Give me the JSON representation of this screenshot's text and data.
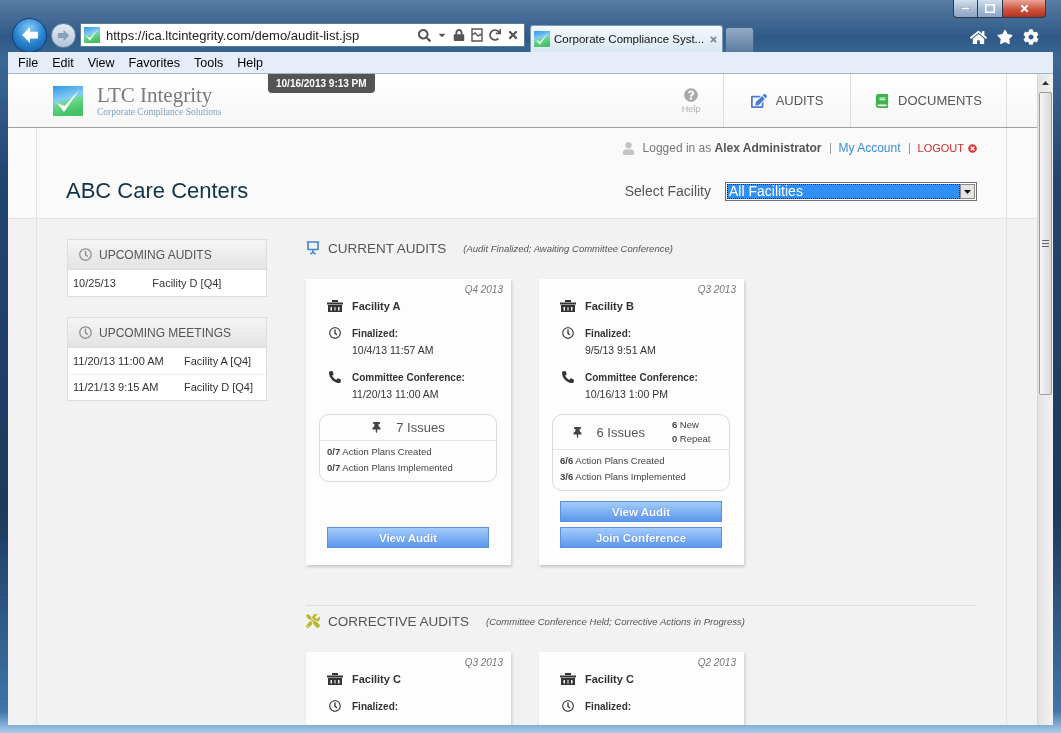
{
  "browser": {
    "address": "https://ica.ltcintegrity.com/demo/audit-list.jsp",
    "tabs": [
      {
        "title": "Corporate Compliance Syst...",
        "selected": true
      }
    ],
    "menu": [
      "File",
      "Edit",
      "View",
      "Favorites",
      "Tools",
      "Help"
    ]
  },
  "tooltip": "10/16/2013 9:13 PM",
  "header": {
    "logo_title": "LTC Integrity",
    "logo_subtitle": "Corporate Compliance Solutions",
    "help_label": "Help",
    "nav": [
      {
        "kind": "audits",
        "label": "AUDITS"
      },
      {
        "kind": "documents",
        "label": "DOCUMENTS"
      }
    ]
  },
  "user_bar": {
    "greeting": "Logged in as **Alex Administrator**",
    "account_link": "My Account",
    "logout": "LOGOUT"
  },
  "page_title": "ABC Care Centers",
  "facility_select": {
    "label": "Select Facility",
    "value": "All Facilities"
  },
  "sidebar": [
    {
      "title": "UPCOMING AUDITS",
      "rows": [
        {
          "date": "10/25/13",
          "facility": "Facility D [Q4]"
        }
      ]
    },
    {
      "title": "UPCOMING MEETINGS",
      "rows": [
        {
          "date": "11/20/13 11:00 AM",
          "facility": "Facility A [Q4]"
        },
        {
          "date": "11/21/13 9:15 AM",
          "facility": "Facility D [Q4]"
        }
      ]
    }
  ],
  "sections": [
    {
      "kind": "current",
      "title": "CURRENT AUDITS",
      "subtitle": "(Audit Finalized; Awaiting Committee Conference)",
      "cards": [
        {
          "quarter": "Q4 2013",
          "facility": "Facility A",
          "fields": [
            {
              "kind": "finalized",
              "label": "Finalized:",
              "value": "10/4/13 11:57 AM"
            },
            {
              "kind": "conference",
              "label": "Committee Conference:",
              "value": "11/20/13 11:00 AM"
            }
          ],
          "issues": {
            "count": "7 Issues",
            "lines": [
              "**0/7** Action Plans Created",
              "**0/7** Action Plans Implemented"
            ]
          },
          "buttons": [
            "View Audit"
          ]
        },
        {
          "quarter": "Q3 2013",
          "facility": "Facility B",
          "fields": [
            {
              "kind": "finalized",
              "label": "Finalized:",
              "value": "9/5/13 9:51 AM"
            },
            {
              "kind": "conference",
              "label": "Committee Conference:",
              "value": "10/16/13 1:00 PM"
            }
          ],
          "issues": {
            "count": "6 Issues",
            "breakdown": [
              "**6** New",
              "**0** Repeat"
            ],
            "lines": [
              "**6/6** Action Plans Created",
              "**3/6** Action Plans Implemented"
            ]
          },
          "buttons": [
            "View Audit",
            "Join Conference"
          ]
        }
      ]
    },
    {
      "kind": "corrective",
      "title": "CORRECTIVE AUDITS",
      "subtitle": "(Committee Conference Held; Corrective Actions in Progress)",
      "cards": [
        {
          "quarter": "Q3 2013",
          "facility": "Facility C",
          "fields": [
            {
              "kind": "finalized",
              "label": "Finalized:"
            }
          ]
        },
        {
          "quarter": "Q2 2013",
          "facility": "Facility C",
          "fields": [
            {
              "kind": "finalized",
              "label": "Finalized:"
            }
          ]
        }
      ]
    }
  ]
}
